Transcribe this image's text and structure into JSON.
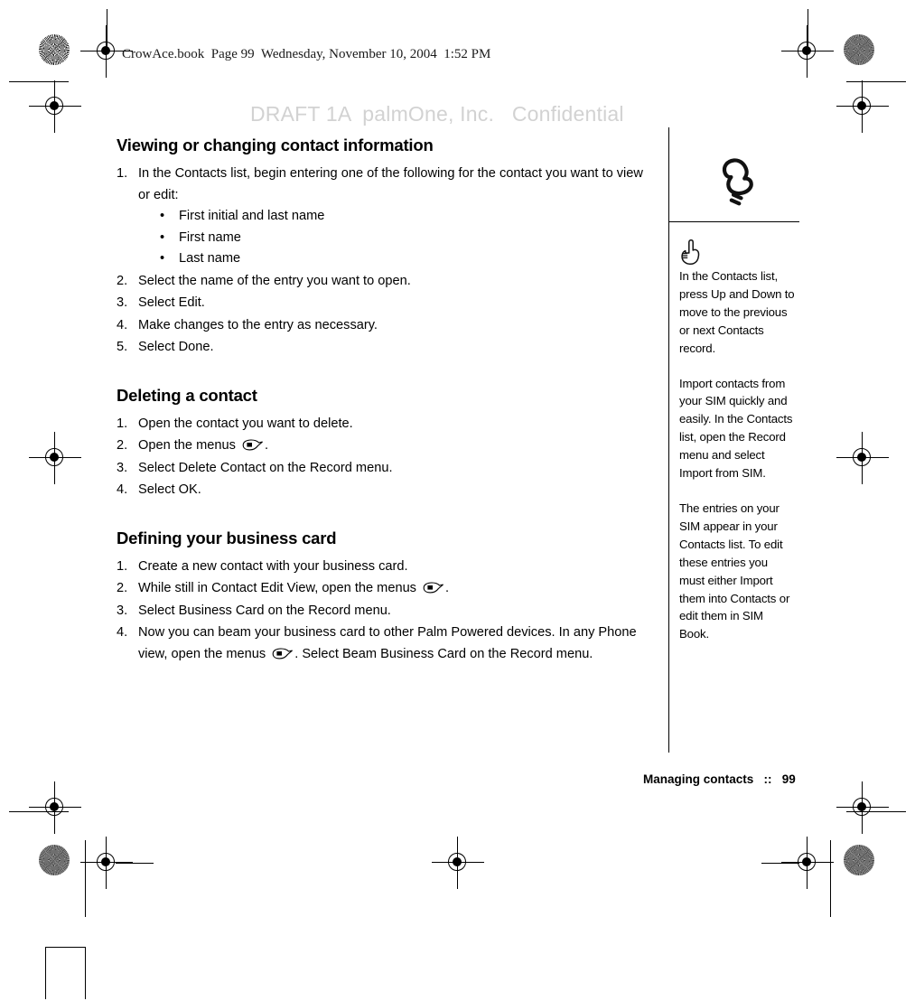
{
  "header": {
    "book_line": "CrowAce.book  Page 99  Wednesday, November 10, 2004  1:52 PM",
    "watermark": "DRAFT 1A  palmOne, Inc.   Confidential",
    "watermark_color": "#d2d2d2"
  },
  "sections": [
    {
      "id": "viewing-or-changing-contact-information",
      "heading": "Viewing or changing contact information",
      "steps": [
        {
          "num": "1.",
          "text": "In the Contacts list, begin entering one of the following for the contact you want to view or edit:",
          "bullets": [
            {
              "bullet": "•",
              "text": "First initial and last name"
            },
            {
              "bullet": "•",
              "text": "First name"
            },
            {
              "bullet": "•",
              "text": "Last name"
            }
          ]
        },
        {
          "num": "2.",
          "text": "Select the name of the entry you want to open."
        },
        {
          "num": "3.",
          "text": "Select Edit."
        },
        {
          "num": "4.",
          "text": "Make changes to the entry as necessary."
        },
        {
          "num": "5.",
          "text": "Select Done."
        }
      ]
    },
    {
      "id": "deleting-a-contact",
      "heading": "Deleting a contact",
      "steps": [
        {
          "num": "1.",
          "text": "Open the contact you want to delete."
        },
        {
          "num": "2.",
          "text_before": "Open the menus ",
          "icon": "menu-icon",
          "text_after": "."
        },
        {
          "num": "3.",
          "text": "Select Delete Contact on the Record menu."
        },
        {
          "num": "4.",
          "text": "Select OK."
        }
      ]
    },
    {
      "id": "defining-your-business-card",
      "heading": "Defining your business card",
      "steps": [
        {
          "num": "1.",
          "text": "Create a new contact with your business card."
        },
        {
          "num": "2.",
          "text_before": "While still in Contact Edit View, open the menus ",
          "icon": "menu-icon",
          "text_after": "."
        },
        {
          "num": "3.",
          "text": "Select Business Card on the Record menu."
        },
        {
          "num": "4.",
          "text_before": "Now you can beam your business card to other Palm Powered devices. In any Phone view, open the menus ",
          "icon": "menu-icon",
          "text_after": ". Select Beam Business Card on the Record  menu."
        }
      ]
    }
  ],
  "sidebar": {
    "top_icon": "phone-handset-icon",
    "tip_icon": "pointing-hand-icon",
    "tips": [
      "In the Contacts list, press Up and Down to move to the previous or next Contacts record.",
      "Import contacts from your SIM quickly and easily. In the Contacts list, open the Record menu and select Import from SIM.",
      "The entries on your SIM appear in your Contacts list. To edit these entries you must either Import them into Contacts or edit them in SIM Book."
    ]
  },
  "footer": {
    "text": "Managing contacts   ::   99"
  }
}
